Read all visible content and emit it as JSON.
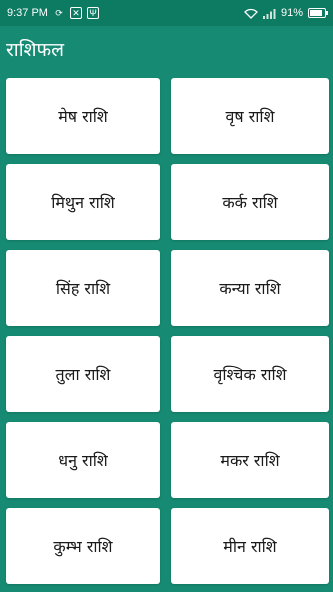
{
  "status_bar": {
    "time": "9:37 PM",
    "left_icons": [
      "sync-icon",
      "notification-icon",
      "usb-icon"
    ],
    "right_icons": [
      "wifi-icon",
      "signal-icon"
    ],
    "battery_percent_text": "91%",
    "battery_level": 0.91
  },
  "app_bar": {
    "title": "राशिफल"
  },
  "signs": [
    {
      "label": "मेष राशि"
    },
    {
      "label": "वृष राशि"
    },
    {
      "label": "मिथुन राशि"
    },
    {
      "label": "कर्क राशि"
    },
    {
      "label": "सिंह राशि"
    },
    {
      "label": "कन्या राशि"
    },
    {
      "label": "तुला राशि"
    },
    {
      "label": "वृश्चिक राशि"
    },
    {
      "label": "धनु राशि"
    },
    {
      "label": "मकर राशि"
    },
    {
      "label": "कुम्भ राशि"
    },
    {
      "label": "मीन राशि"
    }
  ],
  "colors": {
    "primary": "#168a72",
    "status": "#0d7a62",
    "card": "#ffffff"
  }
}
